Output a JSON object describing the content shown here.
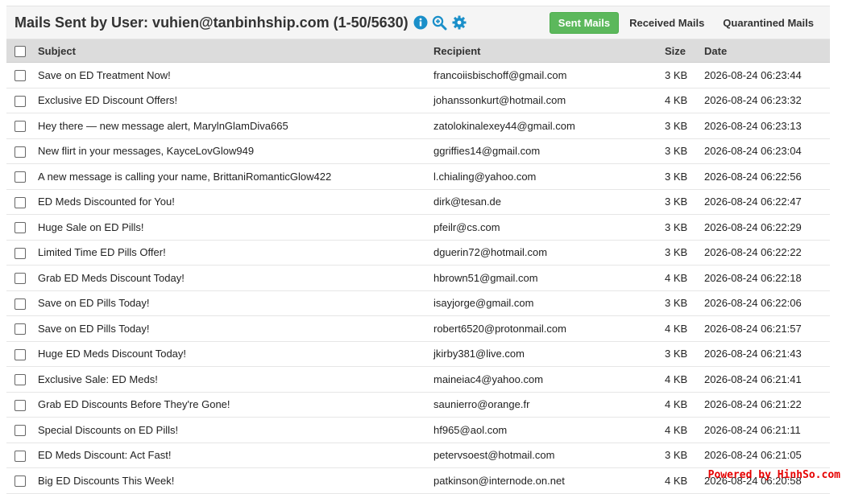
{
  "header": {
    "title": "Mails Sent by User: vuhien@tanbinhship.com (1-50/5630)",
    "icons": [
      "info-icon",
      "zoom-in-icon",
      "gear-icon"
    ]
  },
  "tabs": {
    "sent": "Sent Mails",
    "received": "Received Mails",
    "quarantined": "Quarantined Mails"
  },
  "columns": {
    "subject": "Subject",
    "recipient": "Recipient",
    "size": "Size",
    "date": "Date"
  },
  "rows": [
    {
      "subject": "Save on ED Treatment Now!",
      "recipient": "francoiisbischoff@gmail.com",
      "size": "3 KB",
      "date": "2026-08-24 06:23:44"
    },
    {
      "subject": "Exclusive ED Discount Offers!",
      "recipient": "johanssonkurt@hotmail.com",
      "size": "4 KB",
      "date": "2026-08-24 06:23:32"
    },
    {
      "subject": "Hey there — new message alert, MarylnGlamDiva665",
      "recipient": "zatolokinalexey44@gmail.com",
      "size": "3 KB",
      "date": "2026-08-24 06:23:13"
    },
    {
      "subject": "New flirt in your messages, KayceLovGlow949",
      "recipient": "ggriffies14@gmail.com",
      "size": "3 KB",
      "date": "2026-08-24 06:23:04"
    },
    {
      "subject": "A new message is calling your name, BrittaniRomanticGlow422",
      "recipient": "l.chialing@yahoo.com",
      "size": "3 KB",
      "date": "2026-08-24 06:22:56"
    },
    {
      "subject": "ED Meds Discounted for You!",
      "recipient": "dirk@tesan.de",
      "size": "3 KB",
      "date": "2026-08-24 06:22:47"
    },
    {
      "subject": "Huge Sale on ED Pills!",
      "recipient": "pfeilr@cs.com",
      "size": "3 KB",
      "date": "2026-08-24 06:22:29"
    },
    {
      "subject": "Limited Time ED Pills Offer!",
      "recipient": "dguerin72@hotmail.com",
      "size": "3 KB",
      "date": "2026-08-24 06:22:22"
    },
    {
      "subject": "Grab ED Meds Discount Today!",
      "recipient": "hbrown51@gmail.com",
      "size": "4 KB",
      "date": "2026-08-24 06:22:18"
    },
    {
      "subject": "Save on ED Pills Today!",
      "recipient": "isayjorge@gmail.com",
      "size": "3 KB",
      "date": "2026-08-24 06:22:06"
    },
    {
      "subject": "Save on ED Pills Today!",
      "recipient": "robert6520@protonmail.com",
      "size": "4 KB",
      "date": "2026-08-24 06:21:57"
    },
    {
      "subject": "Huge ED Meds Discount Today!",
      "recipient": "jkirby381@live.com",
      "size": "3 KB",
      "date": "2026-08-24 06:21:43"
    },
    {
      "subject": "Exclusive Sale: ED Meds!",
      "recipient": "maineiac4@yahoo.com",
      "size": "4 KB",
      "date": "2026-08-24 06:21:41"
    },
    {
      "subject": "Grab ED Discounts Before They're Gone!",
      "recipient": "saunierro@orange.fr",
      "size": "4 KB",
      "date": "2026-08-24 06:21:22"
    },
    {
      "subject": "Special Discounts on ED Pills!",
      "recipient": "hf965@aol.com",
      "size": "4 KB",
      "date": "2026-08-24 06:21:11"
    },
    {
      "subject": "ED Meds Discount: Act Fast!",
      "recipient": "petervsoest@hotmail.com",
      "size": "3 KB",
      "date": "2026-08-24 06:21:05"
    },
    {
      "subject": "Big ED Discounts This Week!",
      "recipient": "patkinson@internode.on.net",
      "size": "4 KB",
      "date": "2026-08-24 06:20:58"
    }
  ],
  "watermark": "Powered by HinhSo.com",
  "colors": {
    "active_tab": "#5cb85c",
    "header_bg": "#f5f5f5",
    "table_header_bg": "#dcdcdc",
    "icon_color": "#1a8fc9",
    "watermark": "#e60000"
  }
}
